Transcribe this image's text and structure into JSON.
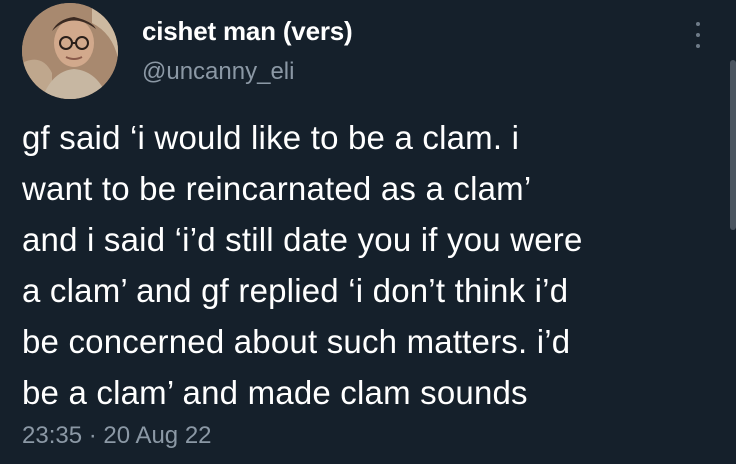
{
  "tweet": {
    "display_name": "cishet man (vers)",
    "handle": "@uncanny_eli",
    "body_lines": [
      "gf said ‘i would like to be a clam. i",
      "want to be reincarnated as a clam’",
      "and i said ‘i’d still date you if you were",
      "a clam’ and gf replied ‘i don’t think i’d",
      "be concerned about such matters. i’d",
      "be a clam’ and made clam sounds"
    ],
    "time": "23:35",
    "separator": "·",
    "date": "20 Aug 22"
  },
  "icons": {
    "more": "more-vertical-icon",
    "avatar": "avatar"
  },
  "colors": {
    "background": "#15202b",
    "text": "#ffffff",
    "muted": "#8b98a5"
  }
}
